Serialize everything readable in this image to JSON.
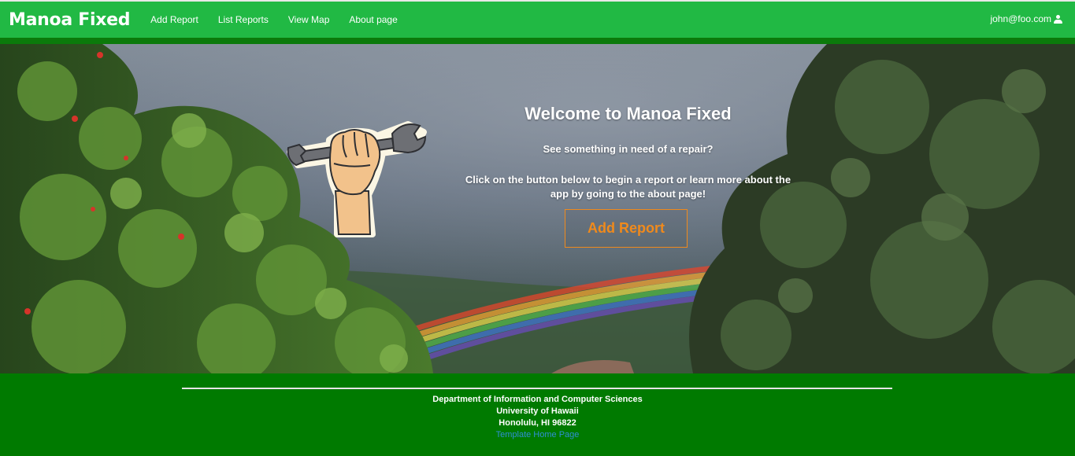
{
  "navbar": {
    "brand": "Manoa Fixed",
    "links": [
      "Add Report",
      "List Reports",
      "View Map",
      "About page"
    ],
    "user": "john@foo.com",
    "user_icon": "user-icon"
  },
  "hero": {
    "title": "Welcome to Manoa Fixed",
    "subtitle": "See something in need of a repair?",
    "description": "Click on the button below to begin a report or learn more about the app by going to the about page!",
    "button": "Add Report",
    "image": "wrench-in-fist-illustration"
  },
  "footer": {
    "line1": "Department of Information and Computer Sciences",
    "line2": "University of Hawaii",
    "line3": "Honolulu, HI 96822",
    "link": "Template Home Page"
  },
  "colors": {
    "nav": "#21b944",
    "footer": "#007a00",
    "accent": "#f08a1c",
    "link": "#2f8fd3"
  }
}
